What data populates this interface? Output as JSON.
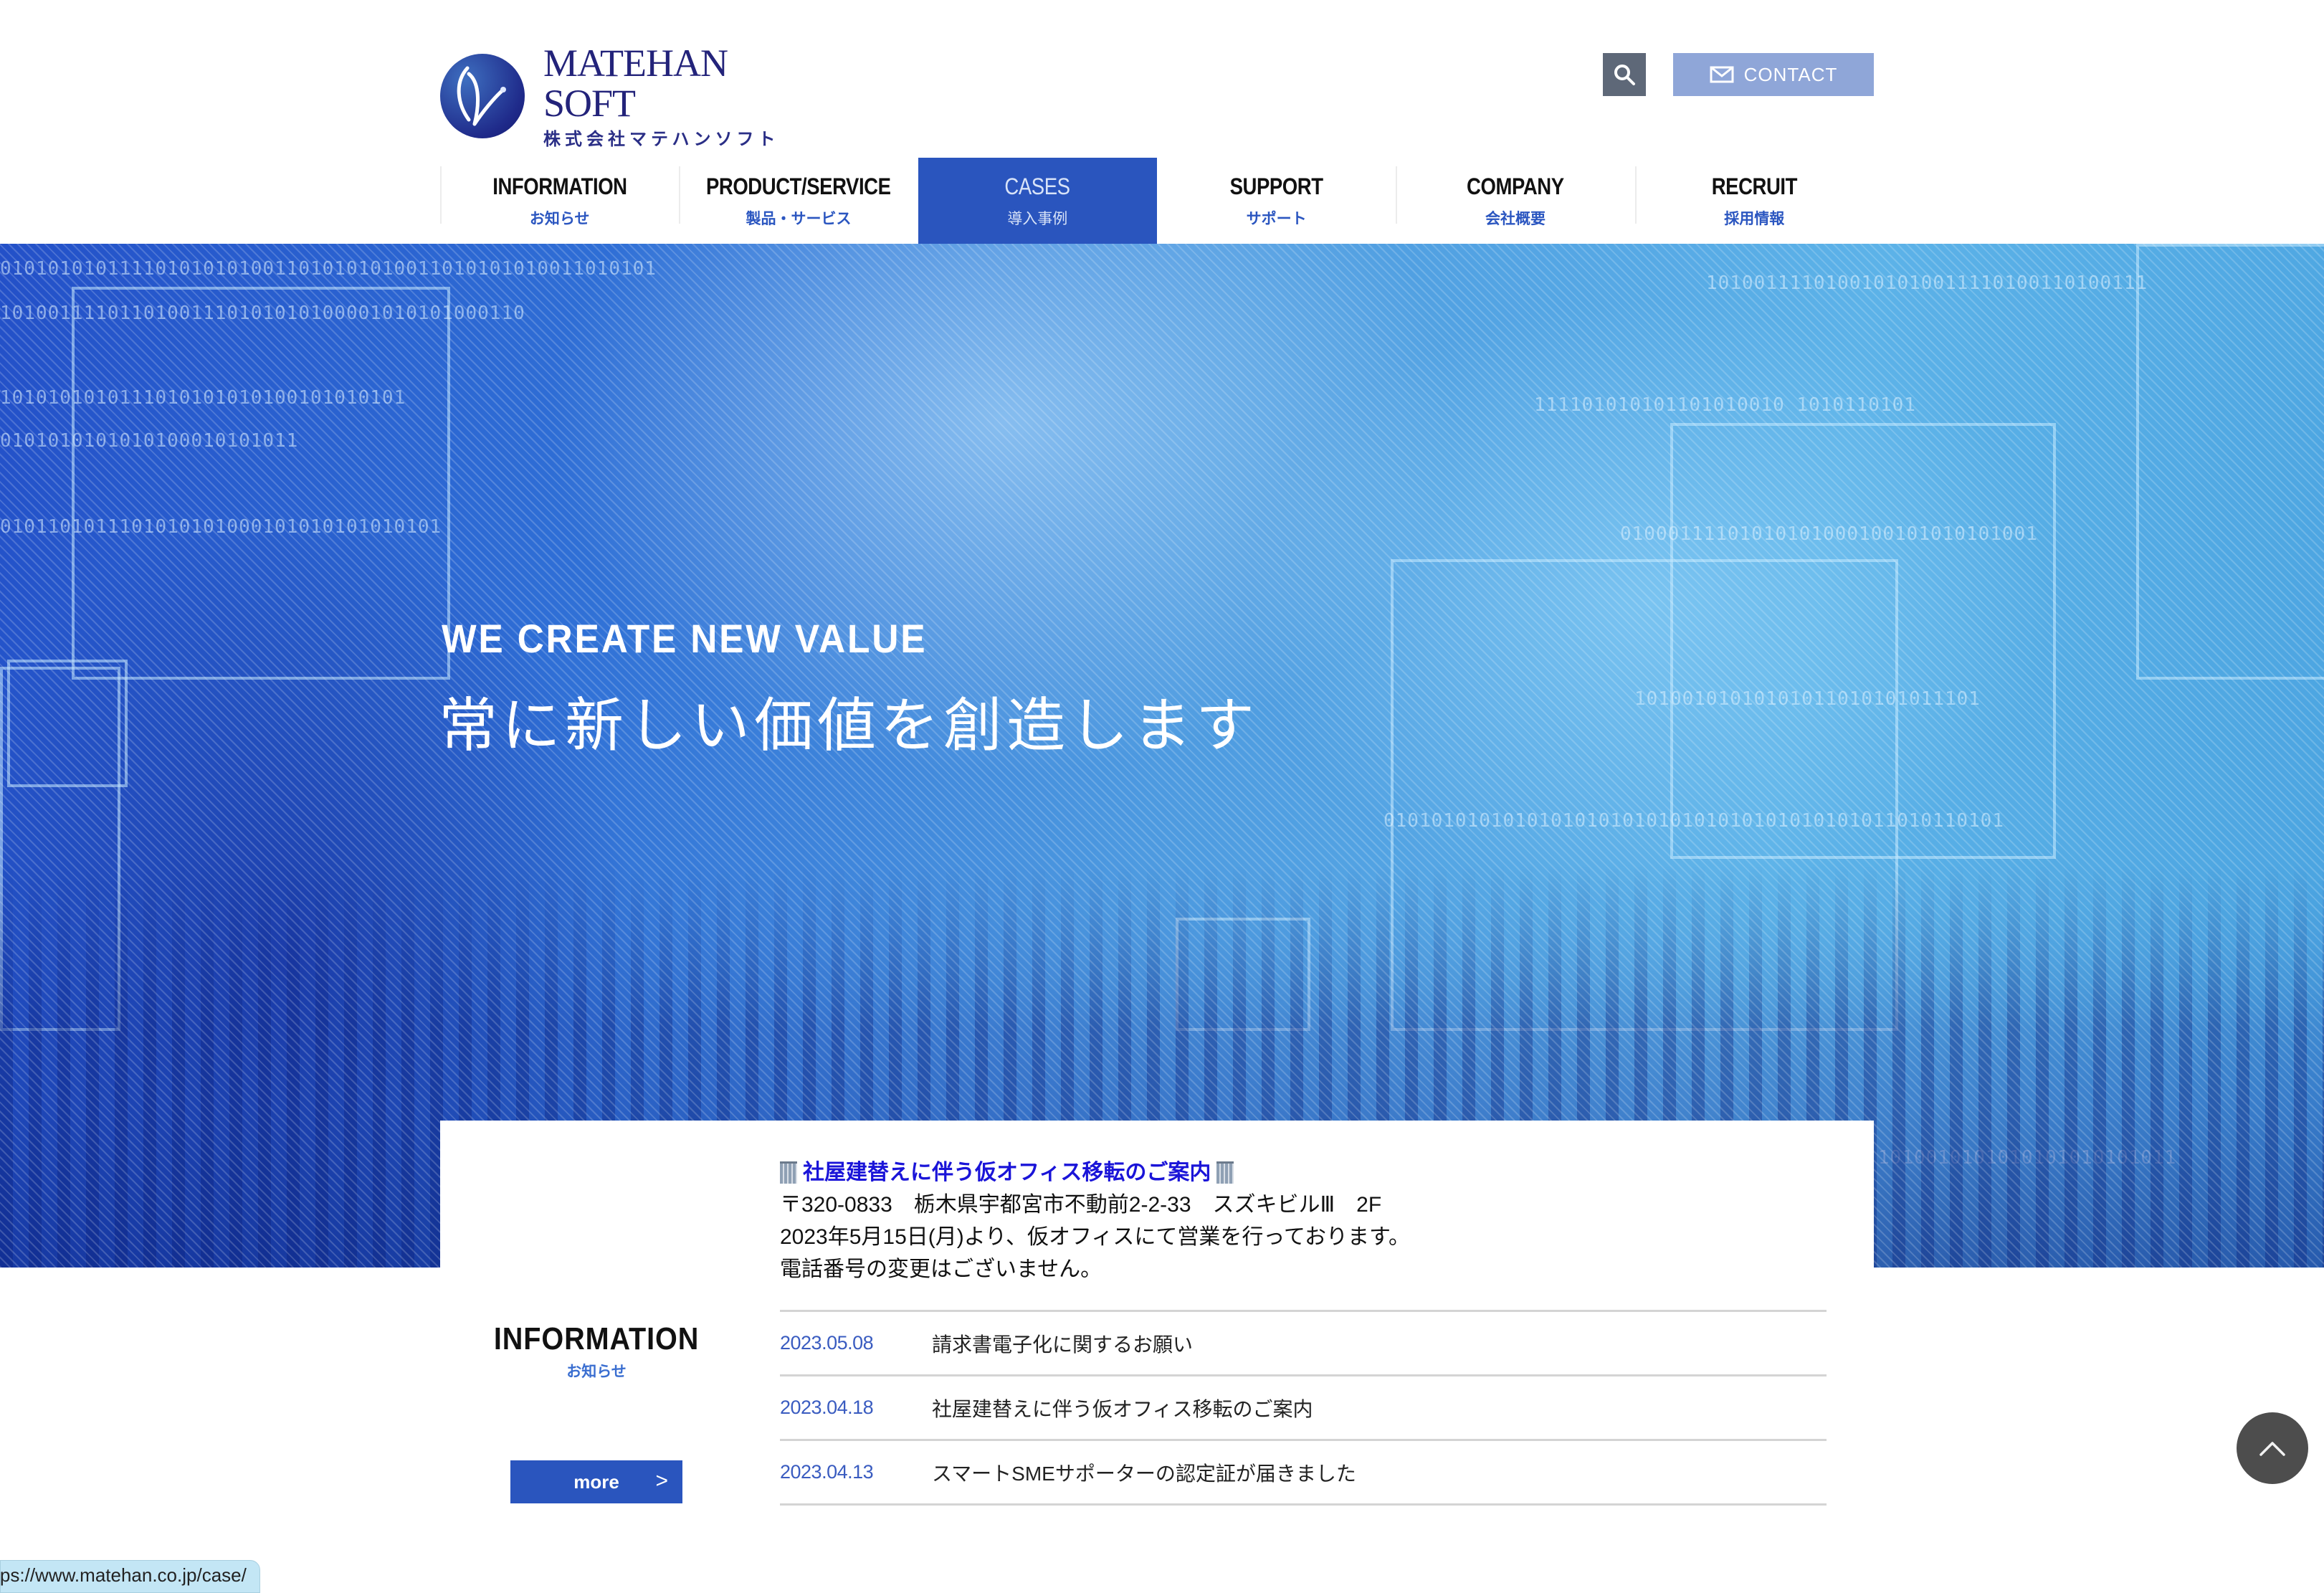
{
  "header": {
    "logo_name": "MATEHAN SOFT",
    "logo_sub": "株式会社マテハンソフト",
    "search_icon": "search-icon",
    "contact_label": "CONTACT",
    "contact_icon": "mail-icon"
  },
  "nav": {
    "items": [
      {
        "en": "INFORMATION",
        "jp": "お知らせ",
        "active": false
      },
      {
        "en": "PRODUCT/SERVICE",
        "jp": "製品・サービス",
        "active": false
      },
      {
        "en": "CASES",
        "jp": "導入事例",
        "active": true
      },
      {
        "en": "SUPPORT",
        "jp": "サポート",
        "active": false
      },
      {
        "en": "COMPANY",
        "jp": "会社概要",
        "active": false
      },
      {
        "en": "RECRUIT",
        "jp": "採用情報",
        "active": false
      }
    ]
  },
  "hero": {
    "tagline_en": "WE CREATE NEW VALUE",
    "tagline_jp": "常に新しい価値を創造します"
  },
  "information": {
    "heading_en": "INFORMATION",
    "heading_jp": "お知らせ",
    "more_label": "more",
    "more_arrow": ">",
    "notice": {
      "title": "社屋建替えに伴う仮オフィス移転のご案内",
      "title_icon": "office-building-icon",
      "lines": [
        "〒320-0833　栃木県宇都宮市不動前2-2-33　スズキビルⅢ　2F",
        "2023年5月15日(月)より、仮オフィスにて営業を行っております。",
        "電話番号の変更はございません。"
      ]
    },
    "news": [
      {
        "date": "2023.05.08",
        "title": "請求書電子化に関するお願い"
      },
      {
        "date": "2023.04.18",
        "title": "社屋建替えに伴う仮オフィス移転のご案内"
      },
      {
        "date": "2023.04.13",
        "title": "スマートSMEサポーターの認定証が届きました"
      }
    ]
  },
  "back_to_top_icon": "chevron-up-icon",
  "status_bar": {
    "url": "https://www.matehan.co.jp/case/"
  },
  "colors": {
    "brand_blue": "#2a55be",
    "contact_bg": "#8fa6d8",
    "search_bg": "#5e6878",
    "date_blue": "#3a5cc0",
    "notice_title": "#1a14d8"
  }
}
